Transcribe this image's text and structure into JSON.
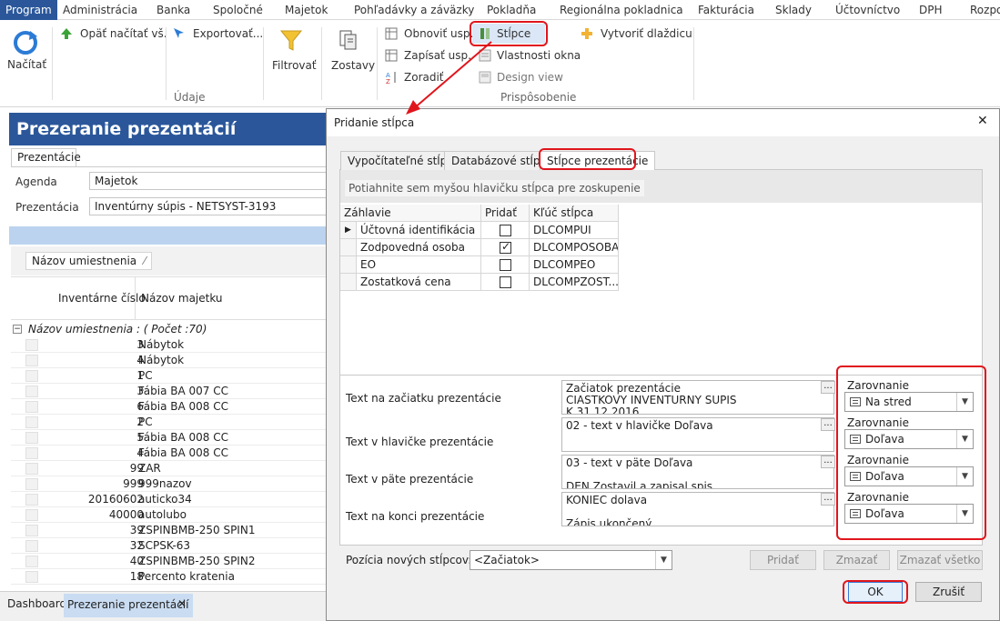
{
  "menu": [
    "Program",
    "Administrácia",
    "Banka",
    "Spoločné",
    "Majetok",
    "Pohľadávky a záväzky",
    "Pokladňa",
    "Regionálna pokladnica",
    "Fakturácia",
    "Sklady",
    "Účtovníctvo",
    "DPH",
    "Rozpo"
  ],
  "ribbon": {
    "nacitat": "Načítať",
    "opat_nacitat": "Opäť načítať vš.",
    "exportovat": "Exportovať...",
    "filtrovat": "Filtrovať",
    "zostavy": "Zostavy",
    "obnovit": "Obnoviť usp.",
    "zapisat": "Zapísať usp.",
    "zoradit": "Zoradiť",
    "stlpce": "Stĺpce",
    "vlastnosti": "Vlastnosti okna",
    "design": "Design view",
    "vytvorit": "Vytvoriť dlaždicu",
    "group_udaje": "Údaje",
    "group_prisposobenie": "Prispôsobenie"
  },
  "left": {
    "title": "Prezeranie prezentácií",
    "tab": "Prezentácie",
    "agenda_label": "Agenda",
    "agenda_value": "Majetok",
    "prez_label": "Prezentácia",
    "prez_value": "Inventúrny súpis - NETSYST-3193",
    "group_chip": "Názov umiestnenia",
    "col_inv": "Inventárne číslo",
    "col_name": "Názov majetku",
    "group_row": "Názov umiestnenia : ( Počet :70)",
    "rows": [
      {
        "num": "3",
        "name": "Nábytok"
      },
      {
        "num": "4",
        "name": "Nábytok"
      },
      {
        "num": "1",
        "name": "PC"
      },
      {
        "num": "3",
        "name": "Fábia BA 007 CC"
      },
      {
        "num": "6",
        "name": "Fábia BA 008 CC"
      },
      {
        "num": "2",
        "name": "PC"
      },
      {
        "num": "5",
        "name": "Fábia BA 008 CC"
      },
      {
        "num": "4",
        "name": "Fábia BA 008 CC"
      },
      {
        "num": "99",
        "name": "ZAR"
      },
      {
        "num": "999",
        "name": "999nazov"
      },
      {
        "num": "20160602",
        "name": "auticko34"
      },
      {
        "num": "40000",
        "name": "autolubo"
      },
      {
        "num": "39",
        "name": "ZSPINBMB-250 SPIN1"
      },
      {
        "num": "32",
        "name": "SCPSK-63"
      },
      {
        "num": "40",
        "name": "ZSPINBMB-250 SPIN2"
      },
      {
        "num": "18",
        "name": "Percento kratenia"
      }
    ]
  },
  "bottom": {
    "dashboard": "Dashboard",
    "active_tab": "Prezeranie prezentácií",
    "close": "✕"
  },
  "dialog": {
    "title": "Pridanie stĺpca",
    "close": "✕",
    "tabs": [
      "Vypočítateľné stĺpce",
      "Databázové stĺpce",
      "Stĺpce prezentácie"
    ],
    "group_hint": "Potiahnite sem myšou hlavičku stĺpca pre zoskupenie",
    "cols": [
      "Záhlavie",
      "Pridať",
      "Kľúč stĺpca"
    ],
    "rows": [
      {
        "name": "Účtovná identifikácia",
        "checked": false,
        "key": "DLCOMPUI"
      },
      {
        "name": "Zodpovedná osoba",
        "checked": true,
        "key": "DLCOMPOSOBA"
      },
      {
        "name": "EO",
        "checked": false,
        "key": "DLCOMPEO"
      },
      {
        "name": "Zostatková cena",
        "checked": false,
        "key": "DLCOMPZOST..."
      }
    ],
    "check_mark": "✓",
    "fields": [
      {
        "label": "Text na začiatku prezentácie",
        "lines": [
          "Začiatok prezentácie",
          "CIASTKOVY INVENTURNY SUPIS",
          "K 31.12.2016"
        ],
        "align_label": "Zarovnanie",
        "align": "Na stred"
      },
      {
        "label": "Text v hlavičke prezentácie",
        "lines": [
          "02 - text v hlavičke Doľava"
        ],
        "align_label": "Zarovnanie",
        "align": "Doľava"
      },
      {
        "label": "Text v päte prezentácie",
        "lines": [
          "03 - text v päte Doľava",
          "",
          "DEN Zostavil a zapisal spis"
        ],
        "align_label": "Zarovnanie",
        "align": "Doľava"
      },
      {
        "label": "Text na konci prezentácie",
        "lines": [
          "KONIEC  dolava",
          "",
          "Zápis ukončený"
        ],
        "align_label": "Zarovnanie",
        "align": "Doľava"
      }
    ],
    "dots": "...",
    "position_label": "Pozícia nových stĺpcov:",
    "position_value": "<Začiatok>",
    "btn_pridat": "Pridať",
    "btn_zmazat": "Zmazať",
    "btn_zmazat_vsetko": "Zmazať všetko",
    "btn_ok": "OK",
    "btn_zrusit": "Zrušiť"
  },
  "colors": {
    "accent": "#2b579a",
    "highlight": "#e0151c"
  }
}
